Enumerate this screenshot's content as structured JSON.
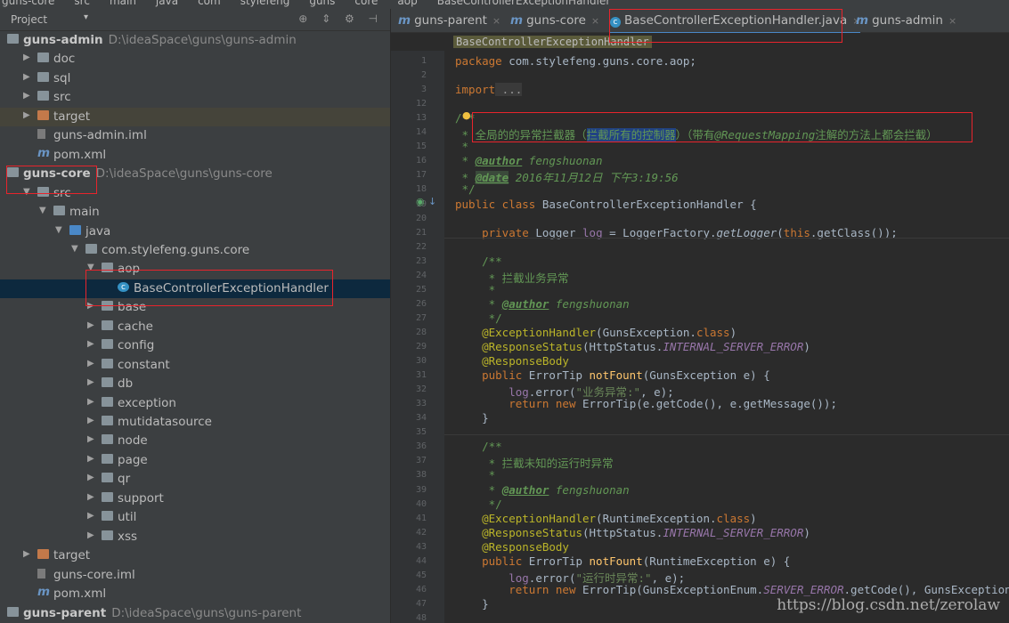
{
  "top_breadcrumb": [
    "guns-core",
    "src",
    "main",
    "java",
    "com",
    "stylefeng",
    "guns",
    "core",
    "aop",
    "BaseControllerExceptionHandler"
  ],
  "project_panel": {
    "title": "Project",
    "tree": [
      {
        "label": "guns-admin",
        "path": "D:\\ideaSpace\\guns\\guns-admin",
        "kind": "module",
        "depth": 0,
        "expanded": true
      },
      {
        "label": "doc",
        "kind": "folder",
        "depth": 1
      },
      {
        "label": "sql",
        "kind": "folder",
        "depth": 1
      },
      {
        "label": "src",
        "kind": "folder",
        "depth": 1
      },
      {
        "label": "target",
        "kind": "folder-orange",
        "depth": 1
      },
      {
        "label": "guns-admin.iml",
        "kind": "file",
        "depth": 1
      },
      {
        "label": "pom.xml",
        "kind": "maven",
        "depth": 1
      },
      {
        "label": "guns-core",
        "path": "D:\\ideaSpace\\guns\\guns-core",
        "kind": "module",
        "depth": 0,
        "expanded": true
      },
      {
        "label": "src",
        "kind": "folder",
        "depth": 1,
        "expanded": true
      },
      {
        "label": "main",
        "kind": "folder",
        "depth": 2,
        "expanded": true
      },
      {
        "label": "java",
        "kind": "folder-src",
        "depth": 3,
        "expanded": true
      },
      {
        "label": "com.stylefeng.guns.core",
        "kind": "package",
        "depth": 4,
        "expanded": true
      },
      {
        "label": "aop",
        "kind": "package",
        "depth": 5,
        "expanded": true
      },
      {
        "label": "BaseControllerExceptionHandler",
        "kind": "class",
        "depth": 6,
        "selected": true
      },
      {
        "label": "base",
        "kind": "package",
        "depth": 5
      },
      {
        "label": "cache",
        "kind": "package",
        "depth": 5
      },
      {
        "label": "config",
        "kind": "package",
        "depth": 5
      },
      {
        "label": "constant",
        "kind": "package",
        "depth": 5
      },
      {
        "label": "db",
        "kind": "package",
        "depth": 5
      },
      {
        "label": "exception",
        "kind": "package",
        "depth": 5
      },
      {
        "label": "mutidatasource",
        "kind": "package",
        "depth": 5
      },
      {
        "label": "node",
        "kind": "package",
        "depth": 5
      },
      {
        "label": "page",
        "kind": "package",
        "depth": 5
      },
      {
        "label": "qr",
        "kind": "package",
        "depth": 5
      },
      {
        "label": "support",
        "kind": "package",
        "depth": 5
      },
      {
        "label": "util",
        "kind": "package",
        "depth": 5
      },
      {
        "label": "xss",
        "kind": "package",
        "depth": 5
      },
      {
        "label": "target",
        "kind": "folder-orange",
        "depth": 1
      },
      {
        "label": "guns-core.iml",
        "kind": "file",
        "depth": 1
      },
      {
        "label": "pom.xml",
        "kind": "maven",
        "depth": 1
      },
      {
        "label": "guns-parent",
        "path": "D:\\ideaSpace\\guns\\guns-parent",
        "kind": "module",
        "depth": 0
      }
    ]
  },
  "editor": {
    "tabs": [
      {
        "label": "guns-parent",
        "icon": "maven-icon"
      },
      {
        "label": "guns-core",
        "icon": "maven-icon"
      },
      {
        "label": "BaseControllerExceptionHandler.java",
        "icon": "class-icon",
        "active": true
      },
      {
        "label": "guns-admin",
        "icon": "maven-icon"
      }
    ],
    "breadcrumb_chip": "BaseControllerExceptionHandler",
    "line_numbers": [
      "1",
      "2",
      "3",
      "12",
      "13",
      "14",
      "15",
      "16",
      "17",
      "18",
      "19",
      "20",
      "21",
      "22",
      "23",
      "24",
      "25",
      "26",
      "27",
      "28",
      "29",
      "30",
      "31",
      "32",
      "33",
      "34",
      "35",
      "36",
      "37",
      "38",
      "39",
      "40",
      "41",
      "42",
      "43",
      "44",
      "45",
      "46",
      "47",
      "48"
    ],
    "code": {
      "l1_kw": "package",
      "l1_rest": " com.stylefeng.guns.core.aop;",
      "l3_kw": "import",
      "l3_rest": " ...",
      "l13": "/**",
      "l14_a": " * ",
      "l14_b": "全局的的异常拦截器（",
      "l14_c": "拦截所有的控制器",
      "l14_d": "）（带有",
      "l14_e": "@RequestMapping",
      "l14_f": "注解的方法上都会拦截）",
      "l15": " *",
      "l16_a": " * ",
      "l16_tag": "@author",
      "l16_b": " fengshuonan",
      "l17_a": " * ",
      "l17_tag": "@date",
      "l17_b": " 2016年11月12日 下午3:19:56",
      "l18": " */",
      "l19_kw": "public class",
      "l19_rest": " BaseControllerExceptionHandler {",
      "l21_kw": "private",
      "l21_a": " Logger ",
      "l21_fld": "log",
      "l21_b": " = LoggerFactory.",
      "l21_mi": "getLogger",
      "l21_c": "(",
      "l21_kw2": "this",
      "l21_d": ".getClass());",
      "l23": "/**",
      "l24": " * 拦截业务异常",
      "l25": " *",
      "l26_a": " * ",
      "l26_tag": "@author",
      "l26_b": " fengshuonan",
      "l27": " */",
      "l28_ann": "@ExceptionHandler",
      "l28_a": "(GunsException.",
      "l28_kw": "class",
      "l28_b": ")",
      "l29_ann": "@ResponseStatus",
      "l29_a": "(HttpStatus.",
      "l29_fld": "INTERNAL_SERVER_ERROR",
      "l29_b": ")",
      "l30_ann": "@ResponseBody",
      "l31_kw": "public",
      "l31_a": " ErrorTip ",
      "l31_fn": "notFount",
      "l31_b": "(GunsException e) {",
      "l32_fld": "log",
      "l32_a": ".error(",
      "l32_str": "\"业务异常:\"",
      "l32_b": ", e);",
      "l33_kw": "return new",
      "l33_a": " ErrorTip(e.getCode(), e.getMessage());",
      "l34": "}",
      "l36": "/**",
      "l37": " * 拦截未知的运行时异常",
      "l38": " *",
      "l39_a": " * ",
      "l39_tag": "@author",
      "l39_b": " fengshuonan",
      "l40": " */",
      "l41_ann": "@ExceptionHandler",
      "l41_a": "(RuntimeException.",
      "l41_kw": "class",
      "l41_b": ")",
      "l42_ann": "@ResponseStatus",
      "l42_a": "(HttpStatus.",
      "l42_fld": "INTERNAL_SERVER_ERROR",
      "l42_b": ")",
      "l43_ann": "@ResponseBody",
      "l44_kw": "public",
      "l44_a": " ErrorTip ",
      "l44_fn": "notFount",
      "l44_b": "(RuntimeException e) {",
      "l45_fld": "log",
      "l45_a": ".error(",
      "l45_str": "\"运行时异常:\"",
      "l45_b": ", e);",
      "l46_kw": "return new",
      "l46_a": " ErrorTip(GunsExceptionEnum.",
      "l46_fld": "SERVER_ERROR",
      "l46_b": ".getCode(), GunsException",
      "l47": "}"
    }
  },
  "watermark": "https://blog.csdn.net/zerolaw",
  "colors": {
    "accent": "#4a88c7",
    "highlight_box": "#e8242c",
    "selection": "#0d293e"
  }
}
